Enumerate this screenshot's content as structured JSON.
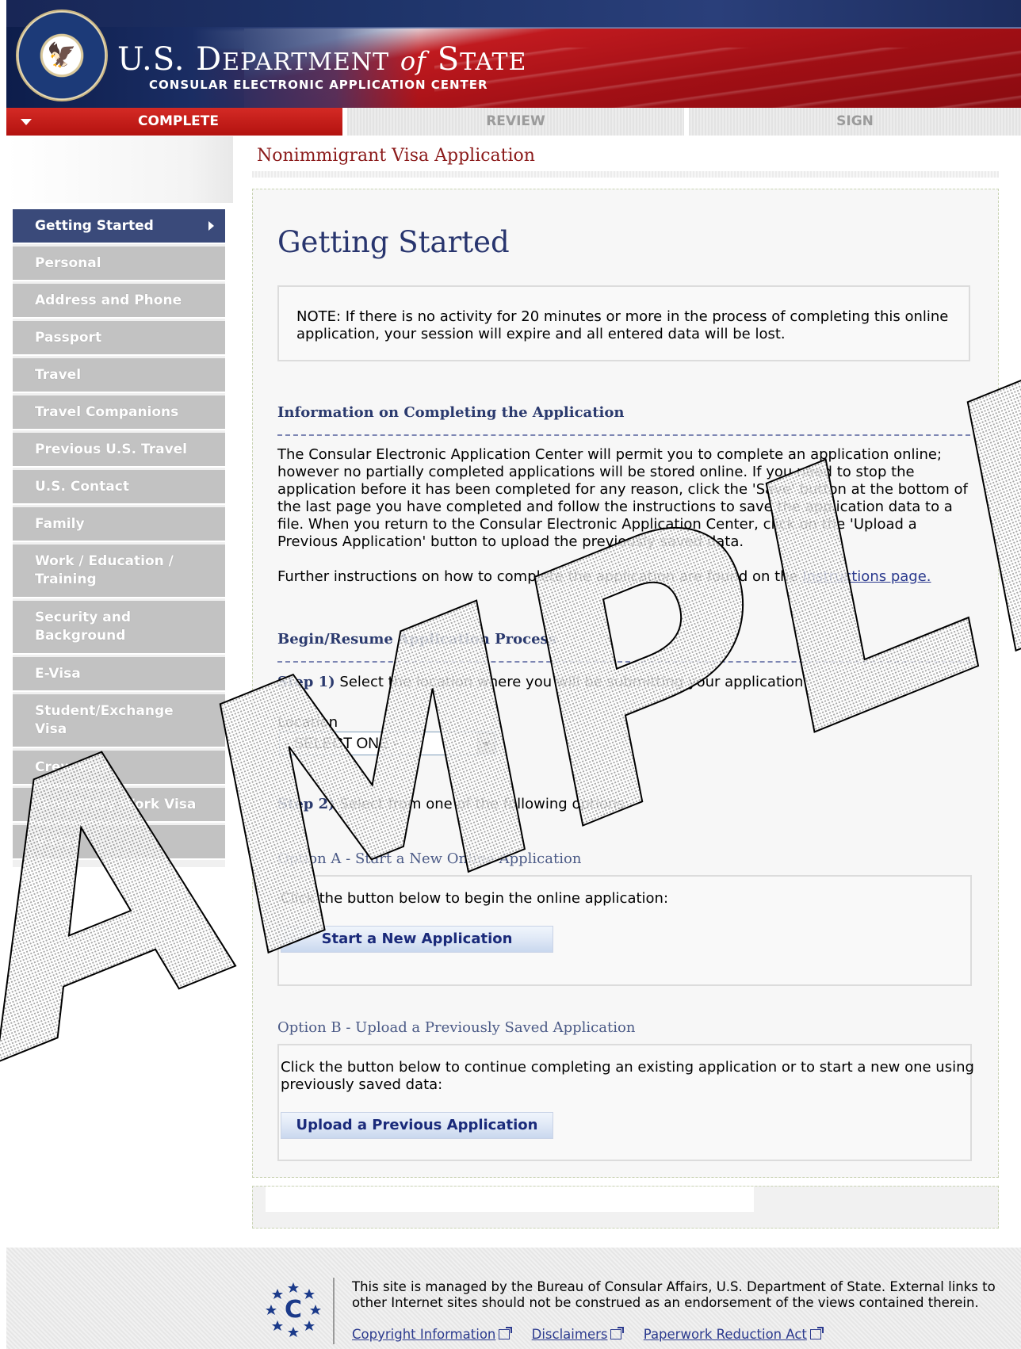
{
  "header": {
    "title_main_a": "U.S. D",
    "title_main_b": "EPARTMENT",
    "title_of": "of",
    "title_state": "S",
    "title_state_b": "TATE",
    "subtitle": "CONSULAR ELECTRONIC APPLICATION CENTER",
    "seal": {
      "text": "DEPARTMENT OF STATE · UNITED STATES OF AMERICA"
    }
  },
  "tabs": [
    {
      "label": "COMPLETE",
      "active": true
    },
    {
      "label": "REVIEW",
      "active": false
    },
    {
      "label": "SIGN",
      "active": false
    }
  ],
  "app_title": "Nonimmigrant Visa Application",
  "sidebar": {
    "items": [
      {
        "label": "Getting Started",
        "active": true
      },
      {
        "label": "Personal"
      },
      {
        "label": "Address and Phone"
      },
      {
        "label": "Passport"
      },
      {
        "label": "Travel"
      },
      {
        "label": "Travel Companions"
      },
      {
        "label": "Previous U.S. Travel"
      },
      {
        "label": "U.S. Contact"
      },
      {
        "label": "Family"
      },
      {
        "label": "Work / Education / Training"
      },
      {
        "label": "Security and Background"
      },
      {
        "label": "E-Visa"
      },
      {
        "label": "Student/Exchange Visa"
      },
      {
        "label": "Crew Visa"
      },
      {
        "label": "Temporary Work Visa"
      },
      {
        "label": "V-Visa"
      }
    ]
  },
  "main": {
    "heading": "Getting Started",
    "note": "NOTE: If there is no activity for 20 minutes or more in the process of completing this online application, your session will expire and all entered data will be lost.",
    "info_heading": "Information on Completing the Application",
    "info_text": "The Consular Electronic Application Center will permit you to complete an application online; however no partially completed applications will be stored online. If you need to stop the application before it has been completed for any reason, click the 'Save' button at the bottom of the last page you have completed and follow the instructions to save the application data to a file. When you return to the Consular Electronic Application Center, click on the 'Upload a Previous Application' button to upload the previously saved data.",
    "further_prefix": "Further instructions on how to complete the application are found on the ",
    "instructions_link": "Instructions page.",
    "begin_heading": "Begin/Resume Application Process",
    "step1_label": "Step 1)",
    "step1_text": " Select the location where you will be submitting your application:",
    "location_label": "Location",
    "location_select": "- SELECT ONE -",
    "step2_label": "Step 2)",
    "step2_text": " Select from one of the following options:",
    "option_a": {
      "heading": "Option A - Start a New Online Application",
      "text": "Click the button below to begin the online application:",
      "button": "Start a New Application"
    },
    "option_b": {
      "heading": "Option B - Upload a Previously Saved Application",
      "text": "Click the button below to continue completing an existing application or to start a new one using previously saved data:",
      "button": "Upload a Previous Application"
    }
  },
  "footer": {
    "text": "This site is managed by the Bureau of Consular Affairs, U.S. Department of State. External links to other Internet sites should not be construed as an endorsement of the views contained therein.",
    "links": [
      "Copyright Information",
      "Disclaimers",
      "Paperwork Reduction Act"
    ]
  },
  "watermark": "SAMPLE",
  "colors": {
    "accent_red": "#b3120f",
    "nav_active": "#3a4a7a",
    "heading_blue": "#28356e",
    "title_red": "#8b1a1a"
  }
}
